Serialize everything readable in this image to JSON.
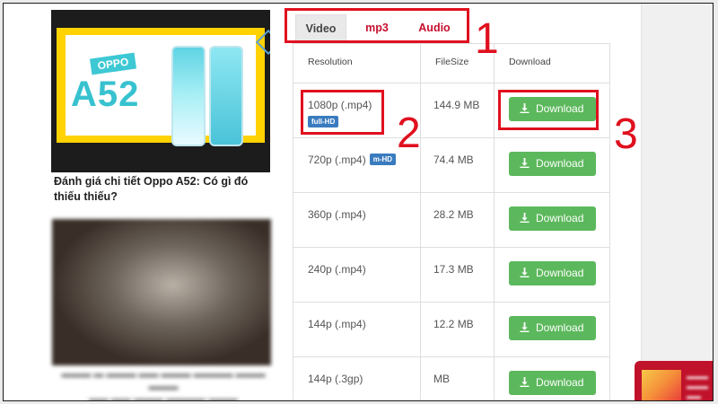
{
  "left_column": {
    "thumbnail": {
      "brand": "OPPO",
      "model": "A52"
    },
    "article_title": "Đánh giá chi tiết Oppo A52: Có gì đó thiếu thiếu?"
  },
  "tabs": [
    {
      "label": "Video",
      "active": true
    },
    {
      "label": "mp3",
      "active": false
    },
    {
      "label": "Audio",
      "active": false
    }
  ],
  "table": {
    "headers": {
      "resolution": "Resolution",
      "filesize": "FileSize",
      "download": "Download"
    },
    "rows": [
      {
        "resolution": "1080p (.mp4)",
        "badge": "full-HD",
        "filesize": "144.9 MB",
        "button": "Download"
      },
      {
        "resolution": "720p (.mp4)",
        "badge": "m-HD",
        "filesize": "74.4 MB",
        "button": "Download"
      },
      {
        "resolution": "360p (.mp4)",
        "badge": "",
        "filesize": "28.2 MB",
        "button": "Download"
      },
      {
        "resolution": "240p (.mp4)",
        "badge": "",
        "filesize": "17.3 MB",
        "button": "Download"
      },
      {
        "resolution": "144p (.mp4)",
        "badge": "",
        "filesize": "12.2 MB",
        "button": "Download"
      },
      {
        "resolution": "144p (.3gp)",
        "badge": "",
        "filesize": "MB",
        "button": "Download"
      }
    ]
  },
  "annotations": {
    "step1": "1",
    "step2": "2",
    "step3": "3"
  },
  "colors": {
    "accent_red": "#e0101e",
    "tab_red": "#c8102e",
    "download_green": "#5cb85c",
    "badge_blue": "#3a7bbf"
  }
}
